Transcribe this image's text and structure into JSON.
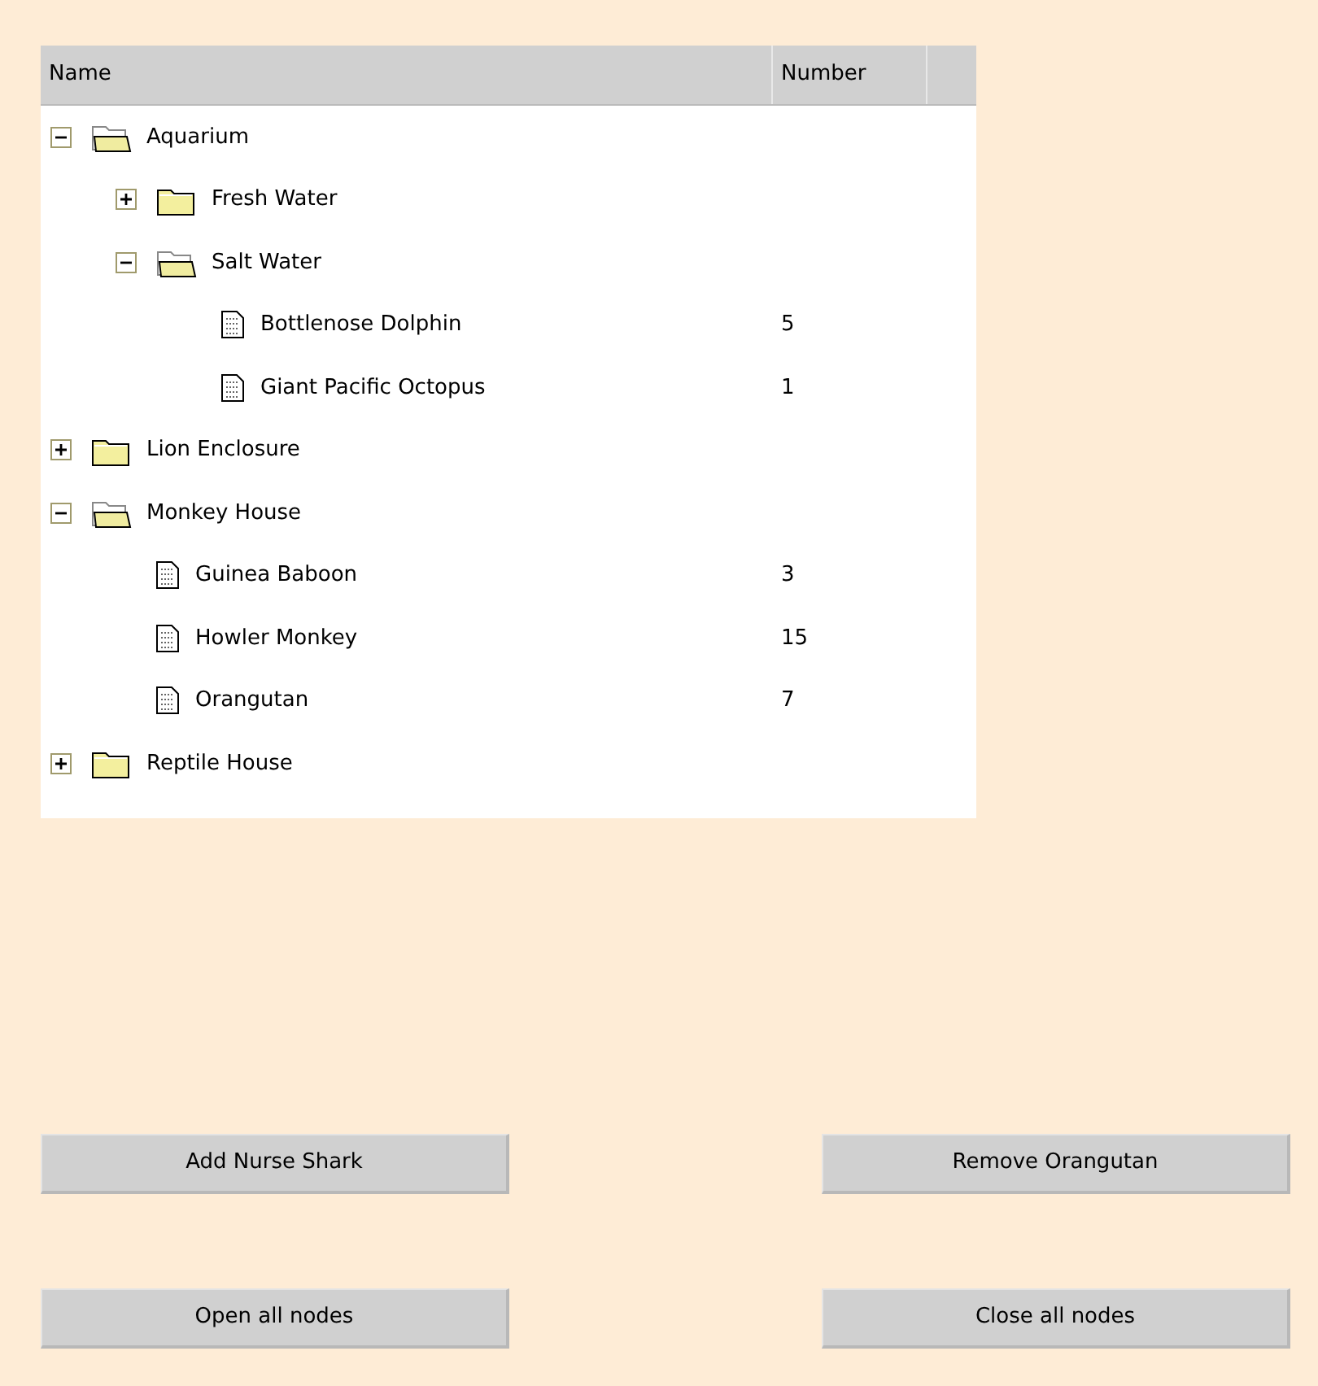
{
  "table": {
    "columns": [
      "Name",
      "Number"
    ],
    "rows": [
      {
        "label": "Aquarium",
        "expanded": true,
        "children": [
          {
            "label": "Fresh Water",
            "expanded": false
          },
          {
            "label": "Salt Water",
            "expanded": true,
            "children": [
              {
                "label": "Bottlenose Dolphin",
                "number": "5"
              },
              {
                "label": "Giant Pacific Octopus",
                "number": "1"
              }
            ]
          }
        ]
      },
      {
        "label": "Lion Enclosure",
        "expanded": false
      },
      {
        "label": "Monkey House",
        "expanded": true,
        "children": [
          {
            "label": "Guinea Baboon",
            "number": "3"
          },
          {
            "label": "Howler Monkey",
            "number": "15"
          },
          {
            "label": "Orangutan",
            "number": "7"
          }
        ]
      },
      {
        "label": "Reptile House",
        "expanded": false
      }
    ]
  },
  "buttons": [
    [
      "Add Nurse Shark",
      "Remove Orangutan"
    ],
    [
      "Open all nodes",
      "Close all nodes"
    ]
  ]
}
